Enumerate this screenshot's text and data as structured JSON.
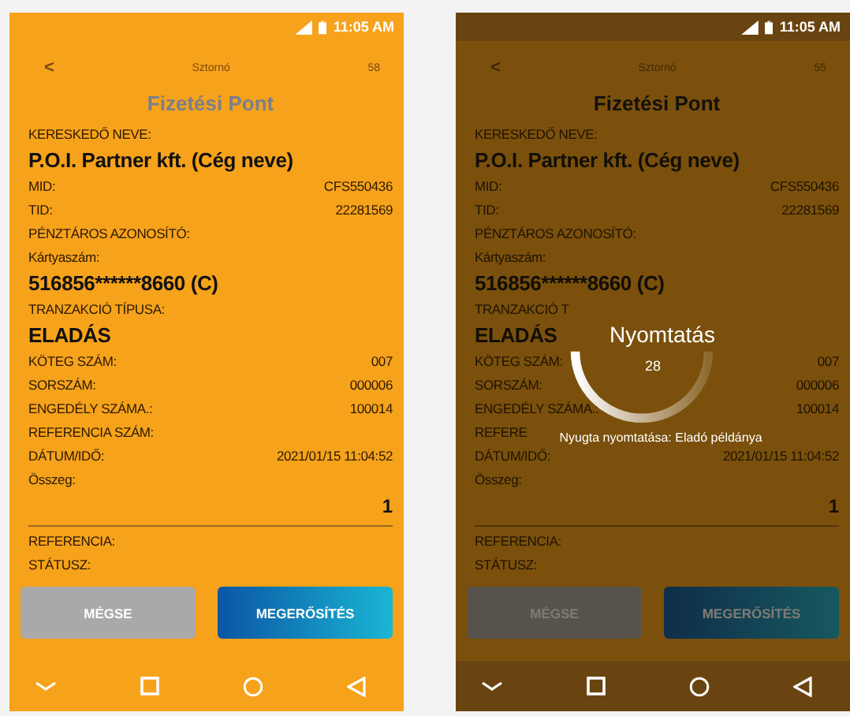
{
  "screens": [
    {
      "dimmed": false,
      "status_bar": {
        "time": "11:05 AM"
      },
      "header": {
        "back": "<",
        "title": "Sztornó",
        "count": "58"
      },
      "heading": "Fizetési Pont",
      "rows": [
        {
          "kind": "label",
          "label": "KERESKEDŐ NEVE:"
        },
        {
          "kind": "value",
          "value": "P.O.I. Partner kft. (Cég neve)"
        },
        {
          "kind": "pair",
          "label": "MID:",
          "value": "CFS550436"
        },
        {
          "kind": "pair",
          "label": "TID:",
          "value": "22281569"
        },
        {
          "kind": "label",
          "label": "PÉNZTÁROS AZONOSÍTÓ:"
        },
        {
          "kind": "label",
          "label": "Kártyaszám:"
        },
        {
          "kind": "value",
          "value": "516856******8660 (C)"
        },
        {
          "kind": "label",
          "label": "TRANZAKCIÓ TÍPUSA:"
        },
        {
          "kind": "value",
          "value": "ELADÁS"
        },
        {
          "kind": "pair",
          "label": "KÖTEG SZÁM:",
          "value": "007"
        },
        {
          "kind": "pair",
          "label": "SORSZÁM:",
          "value": "000006"
        },
        {
          "kind": "pair",
          "label": "ENGEDÉLY SZÁMA.:",
          "value": "100014"
        },
        {
          "kind": "label",
          "label": "REFERENCIA SZÁM:"
        },
        {
          "kind": "pair",
          "label": "DÁTUM/IDŐ:",
          "value": "2021/01/15 11:04:52"
        },
        {
          "kind": "label",
          "label": "Összeg:"
        },
        {
          "kind": "amount",
          "value": "1"
        },
        {
          "kind": "label",
          "label": "REFERENCIA:"
        },
        {
          "kind": "label",
          "label": "STÁTUSZ:"
        }
      ],
      "buttons": [
        {
          "kind": "cancel",
          "label": "MÉGSE"
        },
        {
          "kind": "confirm",
          "label": "MEGERŐSÍTÉS"
        }
      ]
    },
    {
      "dimmed": true,
      "status_bar": {
        "time": "11:05 AM"
      },
      "header": {
        "back": "<",
        "title": "Sztornó",
        "count": "55"
      },
      "heading": "Fizetési Pont",
      "rows": [
        {
          "kind": "label",
          "label": "KERESKEDŐ NEVE:"
        },
        {
          "kind": "value",
          "value": "P.O.I. Partner kft. (Cég neve)"
        },
        {
          "kind": "pair",
          "label": "MID:",
          "value": "CFS550436"
        },
        {
          "kind": "pair",
          "label": "TID:",
          "value": "22281569"
        },
        {
          "kind": "label",
          "label": "PÉNZTÁROS AZONOSÍTÓ:"
        },
        {
          "kind": "label",
          "label": "Kártyaszám:"
        },
        {
          "kind": "value",
          "value": "516856******8660 (C)"
        },
        {
          "kind": "label",
          "label": "TRANZAKCIÓ T"
        },
        {
          "kind": "value",
          "value": "ELADÁS"
        },
        {
          "kind": "pair",
          "label": "KÖTEG SZÁM:",
          "value": "007"
        },
        {
          "kind": "pair",
          "label": "SORSZÁM:",
          "value": "000006"
        },
        {
          "kind": "pair",
          "label": "ENGEDÉLY SZÁMA.:",
          "value": "100014"
        },
        {
          "kind": "label",
          "label": "REFERE"
        },
        {
          "kind": "pair",
          "label": "DÁTUM/IDŐ:",
          "value": "2021/01/15 11:04:52"
        },
        {
          "kind": "label",
          "label": "Összeg:"
        },
        {
          "kind": "amount",
          "value": "1"
        },
        {
          "kind": "label",
          "label": "REFERENCIA:"
        },
        {
          "kind": "label",
          "label": "STÁTUSZ:"
        }
      ],
      "buttons": [
        {
          "kind": "cancel",
          "label": "MÉGSE"
        },
        {
          "kind": "confirm",
          "label": "MEGERŐSÍTÉS"
        }
      ],
      "dialog": {
        "title": "Nyomtatás",
        "count": "28",
        "message": "Nyugta nyomtatása: Eladó példánya"
      }
    }
  ]
}
